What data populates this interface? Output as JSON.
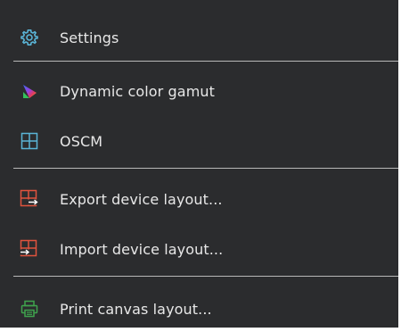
{
  "menu": {
    "items": [
      {
        "label": "Settings",
        "icon": "gear-icon"
      },
      {
        "label": "Dynamic color gamut",
        "icon": "color-gamut-icon"
      },
      {
        "label": "OSCM",
        "icon": "oscm-grid-icon"
      },
      {
        "label": "Export device layout...",
        "icon": "export-layout-icon"
      },
      {
        "label": "Import device layout...",
        "icon": "import-layout-icon"
      },
      {
        "label": "Print canvas layout...",
        "icon": "printer-icon"
      }
    ]
  },
  "colors": {
    "background": "#2b2c2e",
    "text": "#e8e8e8",
    "separator": "#b8b8b8",
    "accent_blue": "#5ab4d6",
    "accent_red": "#e0533d",
    "accent_green": "#3fa34d"
  }
}
